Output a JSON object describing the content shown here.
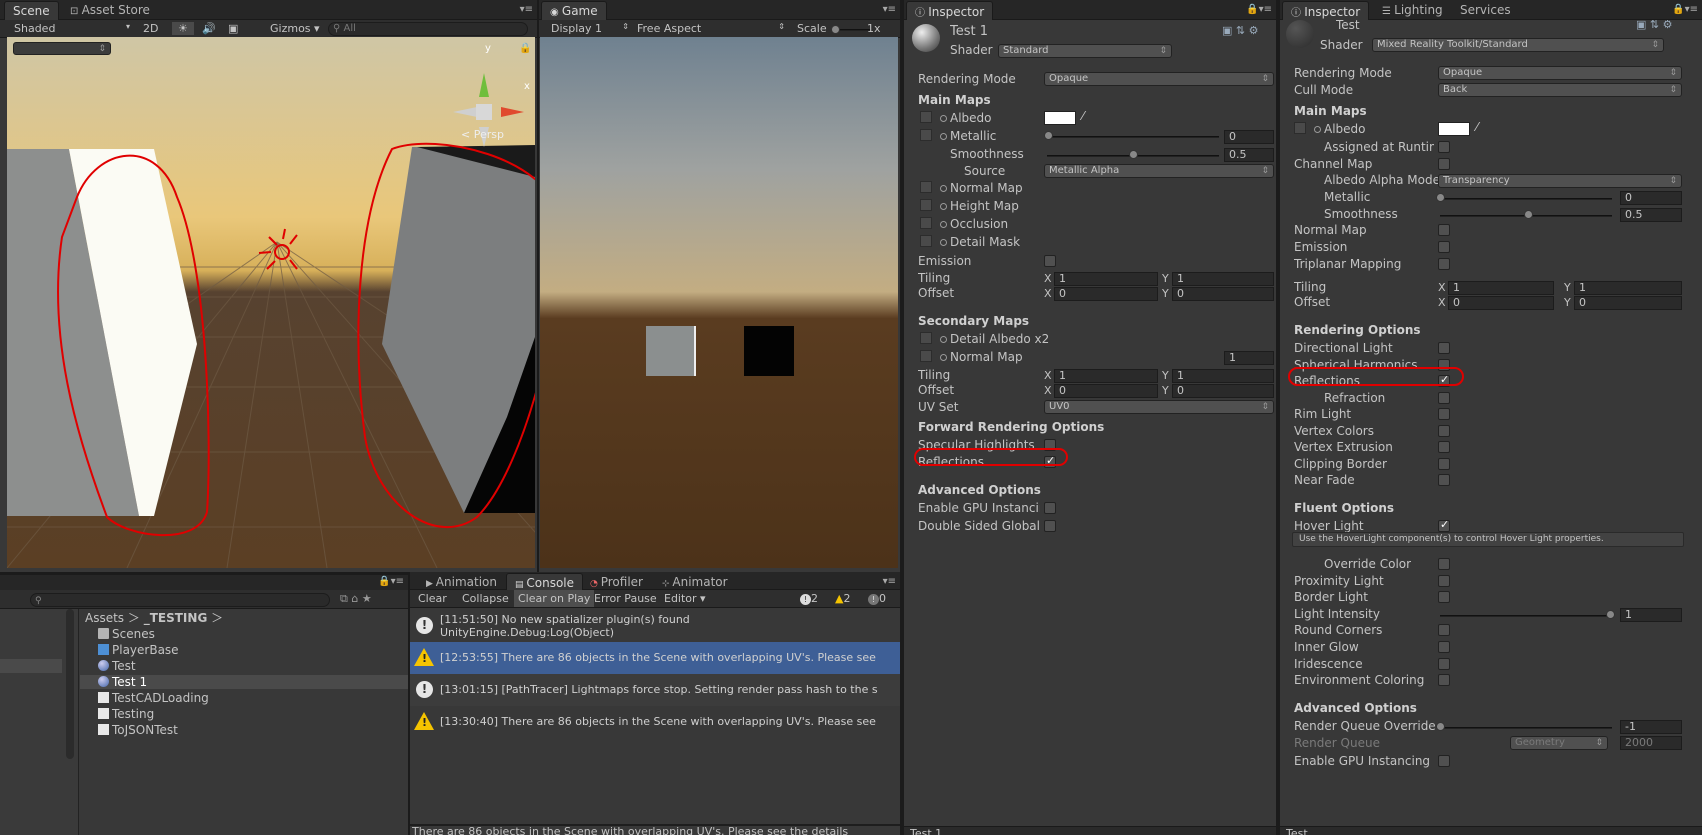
{
  "scene": {
    "tab": "Scene",
    "tab2": "Asset Store",
    "shading": "Shaded",
    "mode2d": "2D",
    "gizmos": "Gizmos",
    "search_placeholder": "All",
    "persp": "Persp",
    "axis_y": "y",
    "axis_x": "x"
  },
  "game": {
    "tab": "Game",
    "display": "Display 1",
    "aspect": "Free Aspect",
    "scale_label": "Scale",
    "scale_value": "1x"
  },
  "inspector_left": {
    "tab": "Inspector",
    "object": "Test 1",
    "shader_label": "Shader",
    "shader": "Standard",
    "rendering_mode_label": "Rendering Mode",
    "rendering_mode": "Opaque",
    "main_maps": "Main Maps",
    "albedo": "Albedo",
    "metallic": "Metallic",
    "metallic_value": "0",
    "smoothness": "Smoothness",
    "smoothness_value": "0.5",
    "source": "Source",
    "source_value": "Metallic Alpha",
    "normal_map": "Normal Map",
    "height_map": "Height Map",
    "occlusion": "Occlusion",
    "detail_mask": "Detail Mask",
    "emission": "Emission",
    "tiling": "Tiling",
    "offset": "Offset",
    "x": "X",
    "y": "Y",
    "tiling_x": "1",
    "tiling_y": "1",
    "offset_x": "0",
    "offset_y": "0",
    "secondary_maps": "Secondary Maps",
    "detail_albedo": "Detail Albedo x2",
    "sec_normal_map": "Normal Map",
    "sec_normal_value": "1",
    "sec_tiling_x": "1",
    "sec_tiling_y": "1",
    "sec_offset_x": "0",
    "sec_offset_y": "0",
    "uv_set": "UV Set",
    "uv_set_value": "UV0",
    "forward_options": "Forward Rendering Options",
    "specular": "Specular Highlights",
    "reflections": "Reflections",
    "advanced": "Advanced Options",
    "gpu_instancing": "Enable GPU Instancing",
    "double_sided": "Double Sided Global Illumination",
    "bottom_label": "Test 1"
  },
  "inspector_right": {
    "tab": "Inspector",
    "tab_lighting": "Lighting",
    "tab_services": "Services",
    "object": "Test",
    "shader_label": "Shader",
    "shader": "Mixed Reality Toolkit/Standard",
    "rendering_mode_label": "Rendering Mode",
    "rendering_mode": "Opaque",
    "cull_mode_label": "Cull Mode",
    "cull_mode": "Back",
    "main_maps": "Main Maps",
    "albedo": "Albedo",
    "assigned_runtime": "Assigned at Runtime",
    "channel_map": "Channel Map",
    "albedo_alpha_mode": "Albedo Alpha Mode",
    "albedo_alpha_value": "Transparency",
    "metallic": "Metallic",
    "metallic_value": "0",
    "smoothness": "Smoothness",
    "smoothness_value": "0.5",
    "normal_map": "Normal Map",
    "emission": "Emission",
    "triplanar": "Triplanar Mapping",
    "tiling": "Tiling",
    "offset": "Offset",
    "x": "X",
    "y": "Y",
    "tiling_x": "1",
    "tiling_y": "1",
    "offset_x": "0",
    "offset_y": "0",
    "rendering_options": "Rendering Options",
    "directional_light": "Directional Light",
    "spherical_harmonics": "Spherical Harmonics",
    "reflections": "Reflections",
    "refraction": "Refraction",
    "rim_light": "Rim Light",
    "vertex_colors": "Vertex Colors",
    "vertex_extrusion": "Vertex Extrusion",
    "clipping_border": "Clipping Border",
    "near_fade": "Near Fade",
    "fluent_options": "Fluent Options",
    "hover_light": "Hover Light",
    "hover_help": "Use the HoverLight component(s) to control Hover Light properties.",
    "override_color": "Override Color",
    "proximity_light": "Proximity Light",
    "border_light": "Border Light",
    "light_intensity": "Light Intensity",
    "light_intensity_value": "1",
    "round_corners": "Round Corners",
    "inner_glow": "Inner Glow",
    "iridescence": "Iridescence",
    "environment_coloring": "Environment Coloring",
    "advanced": "Advanced Options",
    "render_queue_override": "Render Queue Override",
    "render_queue_override_value": "-1",
    "render_queue": "Render Queue",
    "render_queue_mode": "Geometry",
    "render_queue_value": "2000",
    "gpu_instancing": "Enable GPU Instancing",
    "bottom_label": "Test"
  },
  "project": {
    "breadcrumb_assets": "Assets",
    "breadcrumb_folder": "_TESTING",
    "files": [
      "Scenes",
      "PlayerBase",
      "Test",
      "Test 1",
      "TestCADLoading",
      "Testing",
      "ToJSONTest"
    ]
  },
  "console": {
    "tab_animation": "Animation",
    "tab_console": "Console",
    "tab_profiler": "Profiler",
    "tab_animator": "Animator",
    "clear": "Clear",
    "collapse": "Collapse",
    "clear_on_play": "Clear on Play",
    "error_pause": "Error Pause",
    "editor": "Editor",
    "count_info": "2",
    "count_warn": "2",
    "count_error": "0",
    "logs": [
      {
        "type": "info",
        "line1": "[11:51:50] No new spatializer plugin(s) found",
        "line2": "UnityEngine.Debug:Log(Object)"
      },
      {
        "type": "warn",
        "line1": "[12:53:55] There are 86 objects in the Scene with overlapping UV's. Please see",
        "line2": ""
      },
      {
        "type": "info",
        "line1": "[13:01:15] [PathTracer] Lightmaps force stop. Setting render pass hash to the s",
        "line2": ""
      },
      {
        "type": "warn",
        "line1": "[13:30:40] There are 86 objects in the Scene with overlapping UV's. Please see",
        "line2": ""
      }
    ],
    "status": "There are 86 objects in the Scene with overlapping UV's. Please see the details"
  }
}
